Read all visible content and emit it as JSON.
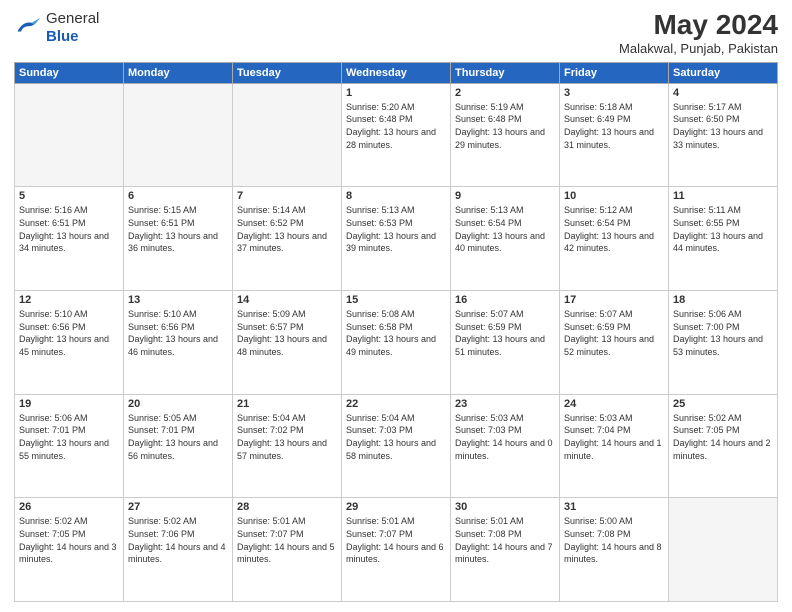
{
  "header": {
    "logo_general": "General",
    "logo_blue": "Blue",
    "month_year": "May 2024",
    "location": "Malakwal, Punjab, Pakistan"
  },
  "days_header": [
    "Sunday",
    "Monday",
    "Tuesday",
    "Wednesday",
    "Thursday",
    "Friday",
    "Saturday"
  ],
  "weeks": [
    [
      {
        "day": "",
        "empty": true
      },
      {
        "day": "",
        "empty": true
      },
      {
        "day": "",
        "empty": true
      },
      {
        "day": "1",
        "sunrise": "Sunrise: 5:20 AM",
        "sunset": "Sunset: 6:48 PM",
        "daylight": "Daylight: 13 hours and 28 minutes."
      },
      {
        "day": "2",
        "sunrise": "Sunrise: 5:19 AM",
        "sunset": "Sunset: 6:48 PM",
        "daylight": "Daylight: 13 hours and 29 minutes."
      },
      {
        "day": "3",
        "sunrise": "Sunrise: 5:18 AM",
        "sunset": "Sunset: 6:49 PM",
        "daylight": "Daylight: 13 hours and 31 minutes."
      },
      {
        "day": "4",
        "sunrise": "Sunrise: 5:17 AM",
        "sunset": "Sunset: 6:50 PM",
        "daylight": "Daylight: 13 hours and 33 minutes."
      }
    ],
    [
      {
        "day": "5",
        "sunrise": "Sunrise: 5:16 AM",
        "sunset": "Sunset: 6:51 PM",
        "daylight": "Daylight: 13 hours and 34 minutes."
      },
      {
        "day": "6",
        "sunrise": "Sunrise: 5:15 AM",
        "sunset": "Sunset: 6:51 PM",
        "daylight": "Daylight: 13 hours and 36 minutes."
      },
      {
        "day": "7",
        "sunrise": "Sunrise: 5:14 AM",
        "sunset": "Sunset: 6:52 PM",
        "daylight": "Daylight: 13 hours and 37 minutes."
      },
      {
        "day": "8",
        "sunrise": "Sunrise: 5:13 AM",
        "sunset": "Sunset: 6:53 PM",
        "daylight": "Daylight: 13 hours and 39 minutes."
      },
      {
        "day": "9",
        "sunrise": "Sunrise: 5:13 AM",
        "sunset": "Sunset: 6:54 PM",
        "daylight": "Daylight: 13 hours and 40 minutes."
      },
      {
        "day": "10",
        "sunrise": "Sunrise: 5:12 AM",
        "sunset": "Sunset: 6:54 PM",
        "daylight": "Daylight: 13 hours and 42 minutes."
      },
      {
        "day": "11",
        "sunrise": "Sunrise: 5:11 AM",
        "sunset": "Sunset: 6:55 PM",
        "daylight": "Daylight: 13 hours and 44 minutes."
      }
    ],
    [
      {
        "day": "12",
        "sunrise": "Sunrise: 5:10 AM",
        "sunset": "Sunset: 6:56 PM",
        "daylight": "Daylight: 13 hours and 45 minutes."
      },
      {
        "day": "13",
        "sunrise": "Sunrise: 5:10 AM",
        "sunset": "Sunset: 6:56 PM",
        "daylight": "Daylight: 13 hours and 46 minutes."
      },
      {
        "day": "14",
        "sunrise": "Sunrise: 5:09 AM",
        "sunset": "Sunset: 6:57 PM",
        "daylight": "Daylight: 13 hours and 48 minutes."
      },
      {
        "day": "15",
        "sunrise": "Sunrise: 5:08 AM",
        "sunset": "Sunset: 6:58 PM",
        "daylight": "Daylight: 13 hours and 49 minutes."
      },
      {
        "day": "16",
        "sunrise": "Sunrise: 5:07 AM",
        "sunset": "Sunset: 6:59 PM",
        "daylight": "Daylight: 13 hours and 51 minutes."
      },
      {
        "day": "17",
        "sunrise": "Sunrise: 5:07 AM",
        "sunset": "Sunset: 6:59 PM",
        "daylight": "Daylight: 13 hours and 52 minutes."
      },
      {
        "day": "18",
        "sunrise": "Sunrise: 5:06 AM",
        "sunset": "Sunset: 7:00 PM",
        "daylight": "Daylight: 13 hours and 53 minutes."
      }
    ],
    [
      {
        "day": "19",
        "sunrise": "Sunrise: 5:06 AM",
        "sunset": "Sunset: 7:01 PM",
        "daylight": "Daylight: 13 hours and 55 minutes."
      },
      {
        "day": "20",
        "sunrise": "Sunrise: 5:05 AM",
        "sunset": "Sunset: 7:01 PM",
        "daylight": "Daylight: 13 hours and 56 minutes."
      },
      {
        "day": "21",
        "sunrise": "Sunrise: 5:04 AM",
        "sunset": "Sunset: 7:02 PM",
        "daylight": "Daylight: 13 hours and 57 minutes."
      },
      {
        "day": "22",
        "sunrise": "Sunrise: 5:04 AM",
        "sunset": "Sunset: 7:03 PM",
        "daylight": "Daylight: 13 hours and 58 minutes."
      },
      {
        "day": "23",
        "sunrise": "Sunrise: 5:03 AM",
        "sunset": "Sunset: 7:03 PM",
        "daylight": "Daylight: 14 hours and 0 minutes."
      },
      {
        "day": "24",
        "sunrise": "Sunrise: 5:03 AM",
        "sunset": "Sunset: 7:04 PM",
        "daylight": "Daylight: 14 hours and 1 minute."
      },
      {
        "day": "25",
        "sunrise": "Sunrise: 5:02 AM",
        "sunset": "Sunset: 7:05 PM",
        "daylight": "Daylight: 14 hours and 2 minutes."
      }
    ],
    [
      {
        "day": "26",
        "sunrise": "Sunrise: 5:02 AM",
        "sunset": "Sunset: 7:05 PM",
        "daylight": "Daylight: 14 hours and 3 minutes."
      },
      {
        "day": "27",
        "sunrise": "Sunrise: 5:02 AM",
        "sunset": "Sunset: 7:06 PM",
        "daylight": "Daylight: 14 hours and 4 minutes."
      },
      {
        "day": "28",
        "sunrise": "Sunrise: 5:01 AM",
        "sunset": "Sunset: 7:07 PM",
        "daylight": "Daylight: 14 hours and 5 minutes."
      },
      {
        "day": "29",
        "sunrise": "Sunrise: 5:01 AM",
        "sunset": "Sunset: 7:07 PM",
        "daylight": "Daylight: 14 hours and 6 minutes."
      },
      {
        "day": "30",
        "sunrise": "Sunrise: 5:01 AM",
        "sunset": "Sunset: 7:08 PM",
        "daylight": "Daylight: 14 hours and 7 minutes."
      },
      {
        "day": "31",
        "sunrise": "Sunrise: 5:00 AM",
        "sunset": "Sunset: 7:08 PM",
        "daylight": "Daylight: 14 hours and 8 minutes."
      },
      {
        "day": "",
        "empty": true
      }
    ]
  ]
}
